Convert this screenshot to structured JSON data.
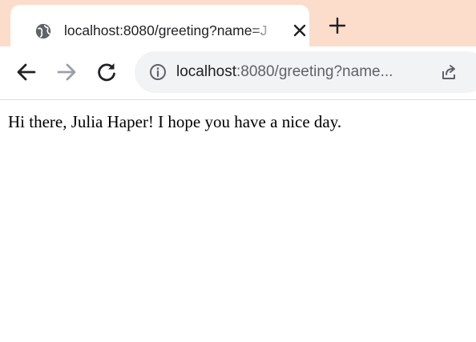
{
  "tab": {
    "title": "localhost:8080/greeting?name=J",
    "favicon": "globe-icon",
    "close_icon": "close-icon"
  },
  "tabstrip": {
    "new_tab_icon": "plus-icon",
    "background_color": "#fcdcca"
  },
  "toolbar": {
    "back_icon": "arrow-left-icon",
    "forward_icon": "arrow-right-icon",
    "reload_icon": "reload-icon"
  },
  "omnibox": {
    "info_icon": "info-icon",
    "url_host": "localhost",
    "url_rest": ":8080/greeting?name...",
    "share_icon": "share-icon"
  },
  "page": {
    "greeting": "Hi there, Julia Haper! I hope you have a nice day."
  }
}
